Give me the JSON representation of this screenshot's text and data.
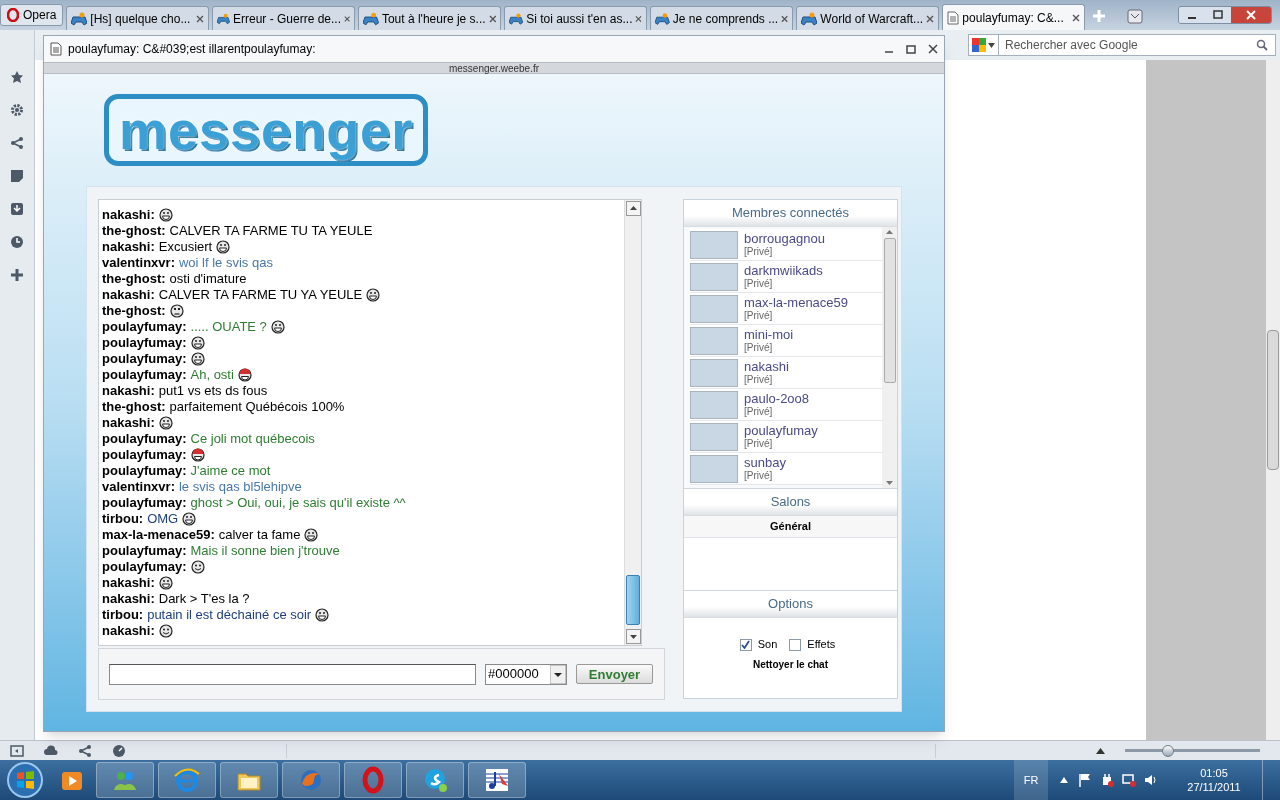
{
  "browser_tabs": [
    {
      "label": "Opera",
      "kind": "menu",
      "selected": false
    },
    {
      "label": "[Hs] quelque cho...",
      "kind": "tab",
      "selected": false
    },
    {
      "label": "Erreur - Guerre de...",
      "kind": "tab",
      "selected": false
    },
    {
      "label": "Tout à l'heure je s...",
      "kind": "tab",
      "selected": false
    },
    {
      "label": "Si toi aussi t'en as...",
      "kind": "tab",
      "selected": false
    },
    {
      "label": "Je ne comprends ...",
      "kind": "tab",
      "selected": false
    },
    {
      "label": "World of Warcraft...",
      "kind": "tab",
      "selected": false
    },
    {
      "label": "poulayfumay: C&...",
      "kind": "tab",
      "selected": true
    }
  ],
  "search": {
    "placeholder": "Rechercher avec Google"
  },
  "popup": {
    "title": "poulayfumay: C&#039;est illarentpoulayfumay:",
    "url": "messenger.weebe.fr",
    "logo": "messenger"
  },
  "chat": {
    "messages": [
      {
        "user": "nakashi:",
        "kind": "grin"
      },
      {
        "user": "the-ghost:",
        "text": "CALVER TA FARME TU TA YEULE",
        "color": "#000000",
        "kind": "plain"
      },
      {
        "user": "nakashi:",
        "text": "Excusiert",
        "color": "#000000",
        "kind": "grin"
      },
      {
        "user": "valentinxvr:",
        "text": "woi lf le svis qas",
        "color": "#4a78a8",
        "kind": "plain"
      },
      {
        "user": "the-ghost:",
        "text": "osti d'imature",
        "color": "#000000",
        "kind": "plain"
      },
      {
        "user": "nakashi:",
        "text": "CALVER TA FARME TU YA YEULE",
        "color": "#000000",
        "kind": "grin"
      },
      {
        "user": "the-ghost:",
        "kind": "dizzy"
      },
      {
        "user": "poulayfumay:",
        "text": "..... OUATE ?",
        "color": "#2e7d32",
        "kind": "grin"
      },
      {
        "user": "poulayfumay:",
        "kind": "grin"
      },
      {
        "user": "poulayfumay:",
        "kind": "grin"
      },
      {
        "user": "poulayfumay:",
        "text": "Ah, osti",
        "color": "#2e7d32",
        "kind": "hat"
      },
      {
        "user": "nakashi:",
        "text": "put1 vs ets ds fous",
        "color": "#000000",
        "kind": "plain"
      },
      {
        "user": "the-ghost:",
        "text": "parfaitement Québécois 100%",
        "color": "#000000",
        "kind": "plain"
      },
      {
        "user": "nakashi:",
        "kind": "grin"
      },
      {
        "user": "poulayfumay:",
        "text": "Ce joli mot québecois",
        "color": "#2e7d32",
        "kind": "plain"
      },
      {
        "user": "poulayfumay:",
        "kind": "hat"
      },
      {
        "user": "poulayfumay:",
        "text": "J'aime ce mot",
        "color": "#2e7d32",
        "kind": "plain"
      },
      {
        "user": "valentinxvr:",
        "text": "le svis qas bl5lehipve",
        "color": "#4a78a8",
        "kind": "plain"
      },
      {
        "user": "poulayfumay:",
        "text": "ghost > Oui, oui, je sais qu'il existe ^^",
        "color": "#2e7d32",
        "kind": "plain"
      },
      {
        "user": "tirbou:",
        "text": "OMG",
        "color": "#1f3f7a",
        "kind": "grin"
      },
      {
        "user": "max-la-menace59:",
        "text": "calver ta fame",
        "color": "#000000",
        "kind": "grin"
      },
      {
        "user": "poulayfumay:",
        "text": "Mais il sonne bien j'trouve",
        "color": "#2e7d32",
        "kind": "plain"
      },
      {
        "user": "poulayfumay:",
        "kind": "smile"
      },
      {
        "user": "nakashi:",
        "kind": "grin"
      },
      {
        "user": "nakashi:",
        "text": "Dark > T'es la ?",
        "color": "#000000",
        "kind": "plain"
      },
      {
        "user": "tirbou:",
        "text": "putain il est déchainé ce soir",
        "color": "#1f3f7a",
        "kind": "grin"
      },
      {
        "user": "nakashi:",
        "kind": "smile"
      }
    ],
    "color_select": "#000000",
    "send_button": "Envoyer"
  },
  "members": {
    "title": "Membres connectés",
    "items": [
      {
        "name": "borrougagnou",
        "link": "[Privé]"
      },
      {
        "name": "darkmwiikads",
        "link": "[Privé]"
      },
      {
        "name": "max-la-menace59",
        "link": "[Privé]"
      },
      {
        "name": "mini-moi",
        "link": "[Privé]"
      },
      {
        "name": "nakashi",
        "link": "[Privé]"
      },
      {
        "name": "paulo-2oo8",
        "link": "[Privé]"
      },
      {
        "name": "poulayfumay",
        "link": "[Privé]"
      },
      {
        "name": "sunbay",
        "link": "[Privé]"
      }
    ]
  },
  "salons": {
    "title": "Salons",
    "items": [
      {
        "label": "Général"
      }
    ]
  },
  "options": {
    "title": "Options",
    "checkboxes": [
      {
        "label": "Son",
        "checked": true
      },
      {
        "label": "Effets",
        "checked": false
      }
    ],
    "clear_button": "Nettoyer le chat"
  },
  "status_bar": {
    "zoom": {
      "level": 0.32
    }
  },
  "taskbar": {
    "language": "FR",
    "time": "01:05",
    "date": "27/11/2011"
  }
}
